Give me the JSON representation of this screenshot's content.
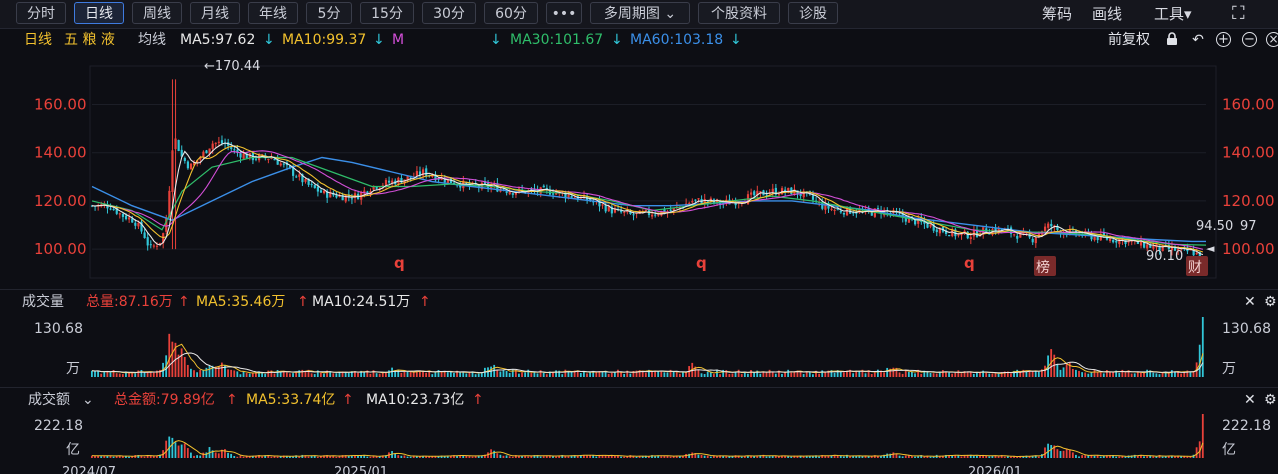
{
  "toolbar": {
    "tabs": [
      "分时",
      "日线",
      "周线",
      "月线",
      "年线",
      "5分",
      "15分",
      "30分",
      "60分",
      "•••",
      "多周期图",
      "个股资料",
      "诊股"
    ],
    "active_tab": "日线",
    "multi_chevron": "⌄",
    "right": {
      "chips": "筹码",
      "draw": "画线",
      "tools": "工具",
      "tools_caret": "▾",
      "fullscreen": "⛶"
    }
  },
  "ma_line": {
    "period": "日线",
    "stock_name": "五 粮 液",
    "ma_label": "均线",
    "ma5": "MA5:97.62",
    "ma10": "MA10:99.37",
    "ma20": "M",
    "ma30": "MA30:101.67",
    "ma60": "MA60:103.18",
    "down_arrow": "↓",
    "adjust": "前复权",
    "icons": {
      "lock": "🔒",
      "undo": "↶",
      "add": "+",
      "remove": "−",
      "close": "×"
    }
  },
  "colors": {
    "ma5": "#e8e8e8",
    "ma10": "#f2c12e",
    "ma20": "#d34fd8",
    "ma30": "#2fbd6a",
    "ma60": "#3b8fe8",
    "up": "#e8413a",
    "down": "#31c6d8",
    "axis_red": "#e8413a",
    "accent": "#3f7be0"
  },
  "price_panel": {
    "y_ticks": [
      "160.00",
      "140.00",
      "120.00",
      "100.00"
    ],
    "high_label": "←170.44",
    "low_label": "90.10",
    "last_label": "94.50",
    "right_overlap": "97",
    "markers": [
      "q",
      "q",
      "q"
    ],
    "badges": [
      "榜",
      "财"
    ],
    "pointer": "◄"
  },
  "volume_panel": {
    "title": "成交量",
    "total": "总量:87.16万",
    "ma5": "MA5:35.46万",
    "ma10": "MA10:24.51万",
    "up_arrow": "↑",
    "max_label": "130.68",
    "unit": "万"
  },
  "amount_panel": {
    "title": "成交额",
    "chevron": "⌄",
    "total": "总金额:79.89亿",
    "ma5": "MA5:33.74亿",
    "ma10": "MA10:23.73亿",
    "up_arrow": "↑",
    "max_label": "222.18",
    "unit": "亿"
  },
  "x_axis": {
    "labels": [
      "2024/07",
      "2025/01",
      "2026/01"
    ]
  },
  "panel_icons": {
    "close": "✕",
    "settings": "⚙"
  },
  "chart_data": {
    "type": "candlestick",
    "ylim": [
      88,
      176
    ],
    "price_path_anchors": [
      [
        0,
        118
      ],
      [
        18,
        118
      ],
      [
        30,
        114
      ],
      [
        42,
        112
      ],
      [
        52,
        106
      ],
      [
        58,
        100
      ],
      [
        64,
        102
      ],
      [
        70,
        104
      ],
      [
        74,
        112
      ],
      [
        78,
        128
      ],
      [
        80,
        142
      ],
      [
        83,
        146
      ],
      [
        90,
        138
      ],
      [
        98,
        134
      ],
      [
        108,
        138
      ],
      [
        120,
        144
      ],
      [
        132,
        144
      ],
      [
        145,
        140
      ],
      [
        160,
        138
      ],
      [
        180,
        138
      ],
      [
        200,
        132
      ],
      [
        218,
        126
      ],
      [
        232,
        123
      ],
      [
        250,
        122
      ],
      [
        265,
        122
      ],
      [
        280,
        126
      ],
      [
        300,
        128
      ],
      [
        320,
        130
      ],
      [
        332,
        132
      ],
      [
        345,
        130
      ],
      [
        360,
        128
      ],
      [
        380,
        126
      ],
      [
        400,
        126
      ],
      [
        420,
        124
      ],
      [
        440,
        124
      ],
      [
        460,
        124
      ],
      [
        480,
        122
      ],
      [
        500,
        120
      ],
      [
        520,
        116
      ],
      [
        540,
        114
      ],
      [
        560,
        115
      ],
      [
        580,
        116
      ],
      [
        600,
        120
      ],
      [
        615,
        120
      ],
      [
        630,
        119
      ],
      [
        645,
        120
      ],
      [
        660,
        122
      ],
      [
        680,
        124
      ],
      [
        700,
        124
      ],
      [
        715,
        122
      ],
      [
        730,
        118
      ],
      [
        745,
        116
      ],
      [
        760,
        116
      ],
      [
        775,
        115
      ],
      [
        790,
        116
      ],
      [
        805,
        114
      ],
      [
        820,
        112
      ],
      [
        835,
        110
      ],
      [
        850,
        108
      ],
      [
        865,
        106
      ],
      [
        880,
        106
      ],
      [
        895,
        108
      ],
      [
        910,
        108
      ],
      [
        925,
        106
      ],
      [
        940,
        104
      ],
      [
        950,
        108
      ],
      [
        958,
        110
      ],
      [
        965,
        108
      ],
      [
        975,
        107
      ],
      [
        990,
        106
      ],
      [
        1005,
        105
      ],
      [
        1020,
        104
      ],
      [
        1030,
        104
      ],
      [
        1040,
        103
      ],
      [
        1050,
        102
      ],
      [
        1060,
        101
      ],
      [
        1070,
        100
      ],
      [
        1080,
        100
      ],
      [
        1090,
        99
      ],
      [
        1100,
        99
      ],
      [
        1108,
        97
      ],
      [
        1114,
        94.5
      ]
    ],
    "ma60_anchors": [
      [
        0,
        126
      ],
      [
        40,
        118
      ],
      [
        80,
        112
      ],
      [
        120,
        120
      ],
      [
        160,
        128
      ],
      [
        200,
        134
      ],
      [
        230,
        138
      ],
      [
        260,
        136
      ],
      [
        300,
        132
      ],
      [
        340,
        128
      ],
      [
        380,
        126
      ],
      [
        420,
        124
      ],
      [
        460,
        122
      ],
      [
        500,
        120
      ],
      [
        540,
        118
      ],
      [
        580,
        118
      ],
      [
        620,
        119
      ],
      [
        660,
        120
      ],
      [
        700,
        120
      ],
      [
        740,
        118
      ],
      [
        780,
        116
      ],
      [
        820,
        113
      ],
      [
        860,
        111
      ],
      [
        900,
        109
      ],
      [
        940,
        107
      ],
      [
        980,
        106
      ],
      [
        1020,
        105
      ],
      [
        1060,
        104
      ],
      [
        1100,
        103.2
      ],
      [
        1114,
        103.18
      ]
    ],
    "ma30_anchors": [
      [
        0,
        120
      ],
      [
        40,
        116
      ],
      [
        70,
        108
      ],
      [
        90,
        124
      ],
      [
        120,
        134
      ],
      [
        160,
        138
      ],
      [
        200,
        138
      ],
      [
        240,
        132
      ],
      [
        280,
        126
      ],
      [
        320,
        126
      ],
      [
        360,
        127
      ],
      [
        400,
        126
      ],
      [
        440,
        124
      ],
      [
        480,
        123
      ],
      [
        520,
        120
      ],
      [
        560,
        116
      ],
      [
        600,
        118
      ],
      [
        640,
        120
      ],
      [
        680,
        122
      ],
      [
        720,
        120
      ],
      [
        760,
        117
      ],
      [
        800,
        114
      ],
      [
        840,
        111
      ],
      [
        880,
        108
      ],
      [
        920,
        107
      ],
      [
        960,
        107
      ],
      [
        1000,
        106
      ],
      [
        1040,
        104
      ],
      [
        1080,
        102
      ],
      [
        1114,
        101.67
      ]
    ],
    "highlights": [
      {
        "x": 82,
        "high": 170.44,
        "low": 100
      },
      {
        "x": 1114,
        "high": 97,
        "low": 90.1
      }
    ],
    "volume_max": 130.68,
    "volume_peaks": [
      [
        80,
        130.68
      ],
      [
        90,
        70
      ],
      [
        118,
        40
      ],
      [
        132,
        38
      ],
      [
        300,
        30
      ],
      [
        400,
        40
      ],
      [
        600,
        32
      ],
      [
        800,
        30
      ],
      [
        960,
        66
      ],
      [
        975,
        40
      ],
      [
        1114,
        130.68
      ]
    ],
    "amount_max": 222.18,
    "amount_peaks": [
      [
        80,
        160
      ],
      [
        90,
        100
      ],
      [
        118,
        60
      ],
      [
        132,
        50
      ],
      [
        300,
        40
      ],
      [
        400,
        50
      ],
      [
        600,
        40
      ],
      [
        800,
        40
      ],
      [
        960,
        110
      ],
      [
        975,
        60
      ],
      [
        1114,
        222.18
      ]
    ]
  }
}
